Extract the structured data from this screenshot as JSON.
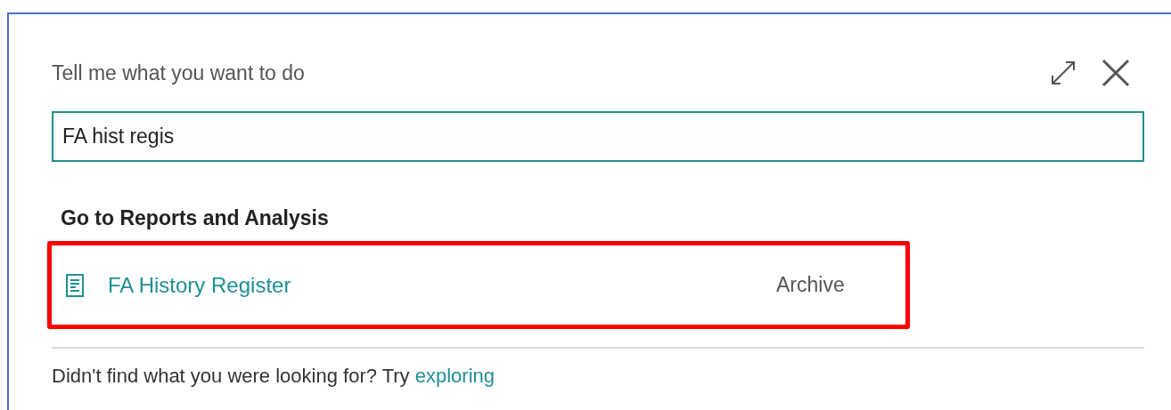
{
  "dialog": {
    "title": "Tell me what you want to do"
  },
  "search": {
    "value": "FA hist regis"
  },
  "section": {
    "heading": "Go to Reports and Analysis"
  },
  "results": [
    {
      "label": "FA History Register",
      "category": "Archive",
      "highlighted": true
    }
  ],
  "footer": {
    "text": "Didn't find what you were looking for? Try",
    "link": "exploring"
  }
}
